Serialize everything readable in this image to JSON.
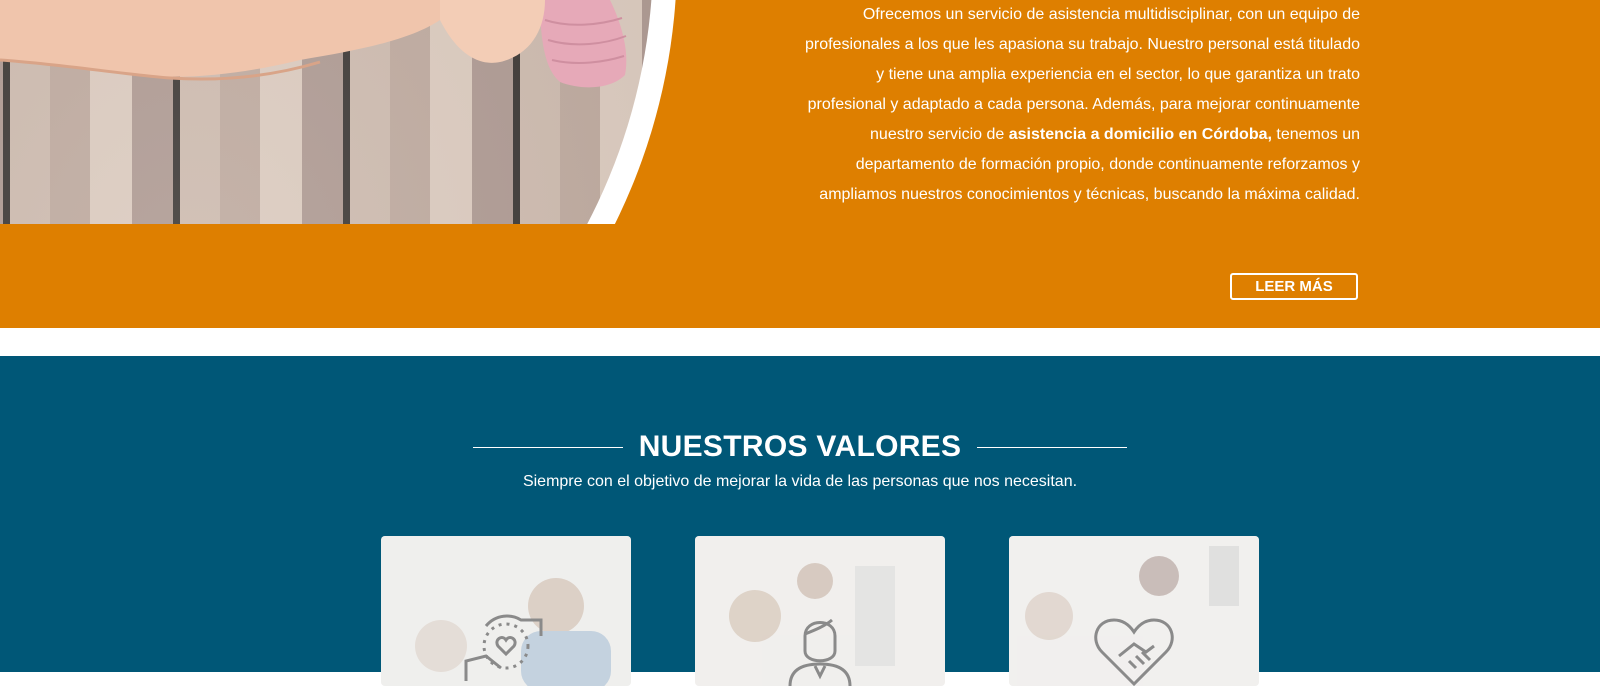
{
  "intro": {
    "text_before": "Ofrecemos un servicio de asistencia multidisciplinar, con un equipo de profesionales a los que les apasiona su trabajo. Nuestro personal está titulado y tiene una amplia experiencia en el sector, lo que garantiza un trato profesional y adaptado a cada persona. Además, para mejorar continuamente nuestro servicio de ",
    "text_bold": "asistencia a domicilio en Córdoba,",
    "text_after": " tenemos un departamento de formación propio, donde continuamente reforzamos y ampliamos nuestros conocimientos y técnicas, buscando la máxima calidad."
  },
  "read_more_label": "LEER MÁS",
  "values": {
    "title": "NUESTROS VALORES",
    "subtitle": "Siempre con el objetivo de mejorar la vida de las personas que nos necesitan.",
    "cards": [
      {
        "icon": "hands-heart-icon"
      },
      {
        "icon": "caregiver-icon"
      },
      {
        "icon": "heart-handshake-icon"
      }
    ]
  },
  "colors": {
    "orange": "#de7f00",
    "blue": "#005777",
    "white": "#ffffff"
  }
}
